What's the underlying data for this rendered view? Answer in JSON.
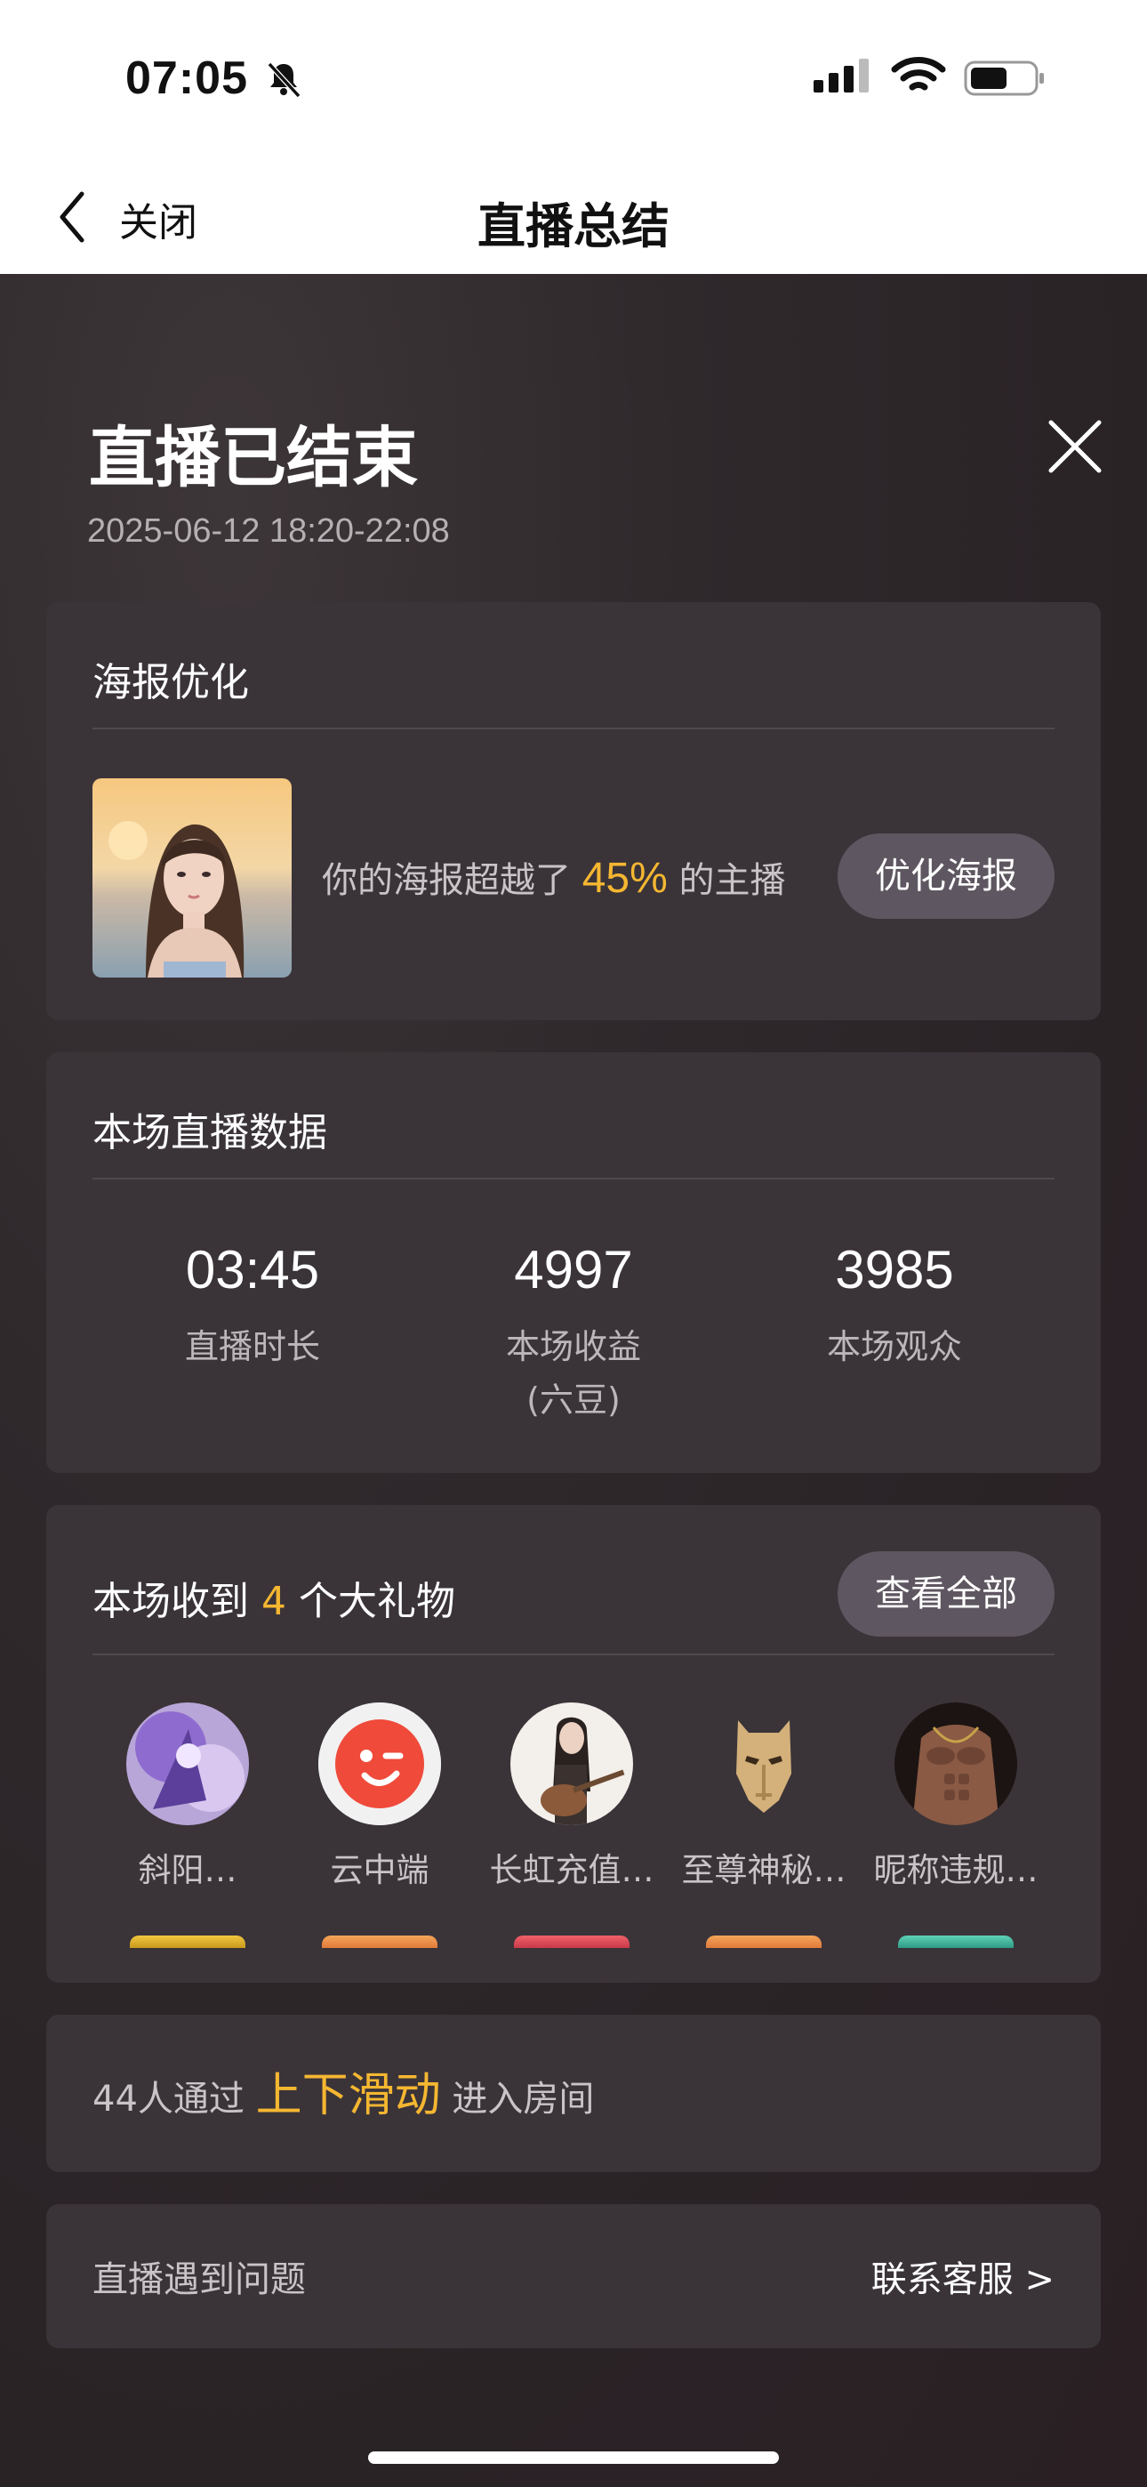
{
  "status_bar": {
    "time": "07:05"
  },
  "nav": {
    "back_label": "关闭",
    "title": "直播总结"
  },
  "header": {
    "title": "直播已结束",
    "date_range": "2025-06-12 18:20-22:08"
  },
  "poster_card": {
    "title": "海报优化",
    "text_before": "你的海报超越了 ",
    "percent": "45%",
    "text_after": " 的主播",
    "button": "优化海报"
  },
  "stats_card": {
    "title": "本场直播数据",
    "items": [
      {
        "value": "03:45",
        "label": "直播时长"
      },
      {
        "value": "4997",
        "label": "本场收益\n(六豆)"
      },
      {
        "value": "3985",
        "label": "本场观众"
      }
    ]
  },
  "gifts_card": {
    "title_before": "本场收到 ",
    "count": "4",
    "title_after": " 个大礼物",
    "button": "查看全部",
    "gifts": [
      {
        "name": "斜阳…",
        "avatar": "fantasy-avatar"
      },
      {
        "name": "云中端",
        "avatar": "wink-avatar"
      },
      {
        "name": "长虹充值…",
        "avatar": "guitar-girl-avatar"
      },
      {
        "name": "至尊神秘…",
        "avatar": "golden-mask-avatar"
      },
      {
        "name": "昵称违规…",
        "avatar": "muscle-avatar"
      }
    ]
  },
  "slide_card": {
    "text_before": "44人通过 ",
    "highlight": "上下滑动",
    "text_after": " 进入房间"
  },
  "help_card": {
    "left": "直播遇到问题",
    "right": "联系客服 >"
  },
  "colors": {
    "accent": "#f5b731",
    "card": "#3a3439",
    "button": "#5e5660"
  }
}
